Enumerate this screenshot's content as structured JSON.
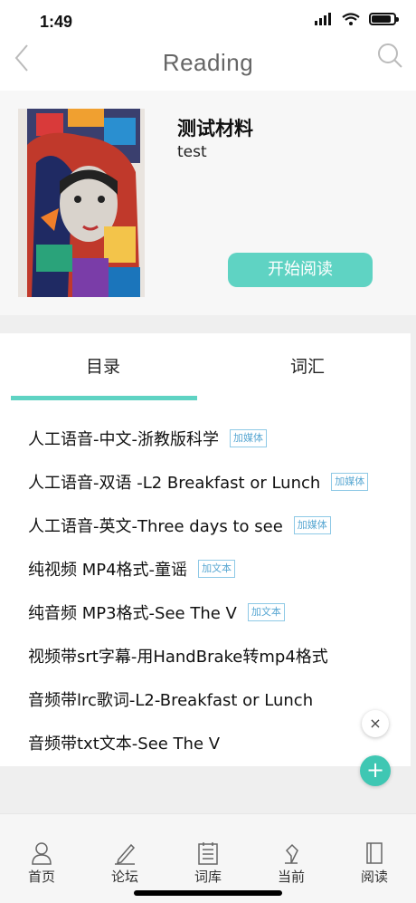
{
  "status_bar": {
    "time": "1:49"
  },
  "navbar": {
    "title": "Reading"
  },
  "book": {
    "title": "测试材料",
    "subtitle": "test",
    "start_label": "开始阅读"
  },
  "tabs": [
    {
      "label": "目录",
      "active": true
    },
    {
      "label": "词汇",
      "active": false
    }
  ],
  "chapters": [
    {
      "title": "人工语音-中文-浙教版科学",
      "tag": "加媒体"
    },
    {
      "title": "人工语音-双语 -L2 Breakfast or Lunch",
      "tag": "加媒体"
    },
    {
      "title": "人工语音-英文-Three days to see",
      "tag": "加媒体"
    },
    {
      "title": "纯视频 MP4格式-童谣",
      "tag": "加文本"
    },
    {
      "title": "纯音频 MP3格式-See The V",
      "tag": "加文本"
    },
    {
      "title": "视频带srt字幕-用HandBrake转mp4格式",
      "tag": ""
    },
    {
      "title": "音频带lrc歌词-L2-Breakfast or Lunch",
      "tag": ""
    },
    {
      "title": "音频带txt文本-See The V",
      "tag": ""
    }
  ],
  "floating": {
    "close_symbol": "×",
    "add_symbol": "+"
  },
  "tabbar": [
    {
      "label": "首页",
      "icon": "user-icon"
    },
    {
      "label": "论坛",
      "icon": "pen-icon"
    },
    {
      "label": "词库",
      "icon": "list-icon"
    },
    {
      "label": "当前",
      "icon": "lamp-icon"
    },
    {
      "label": "阅读",
      "icon": "book-icon"
    }
  ],
  "colors": {
    "accent": "#5fd3c3",
    "tag": "#58a7d2"
  }
}
